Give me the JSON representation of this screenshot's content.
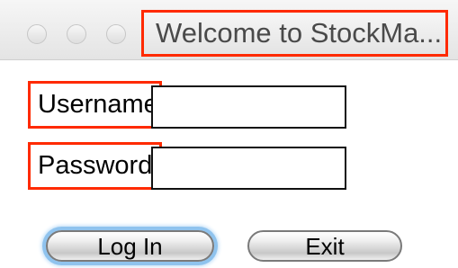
{
  "window": {
    "title": "Welcome to StockMa...",
    "controls": [
      "close",
      "minimize",
      "zoom"
    ]
  },
  "form": {
    "username_label": "Username",
    "username_value": "",
    "password_label": "Password",
    "password_value": ""
  },
  "buttons": {
    "login_label": "Log In",
    "exit_label": "Exit"
  },
  "colors": {
    "highlight_border": "#ff2a00",
    "focus_ring": "#8fc3ee"
  }
}
